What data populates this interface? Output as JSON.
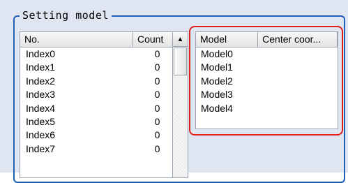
{
  "group": {
    "title": "Setting model"
  },
  "left_list": {
    "columns": [
      "No.",
      "Count"
    ],
    "rows": [
      {
        "no": "Index0",
        "count": "0"
      },
      {
        "no": "Index1",
        "count": "0"
      },
      {
        "no": "Index2",
        "count": "0"
      },
      {
        "no": "Index3",
        "count": "0"
      },
      {
        "no": "Index4",
        "count": "0"
      },
      {
        "no": "Index5",
        "count": "0"
      },
      {
        "no": "Index6",
        "count": "0"
      },
      {
        "no": "Index7",
        "count": "0"
      }
    ],
    "scroll_up_icon": "▲"
  },
  "right_list": {
    "columns": [
      "Model",
      "Center coor..."
    ],
    "rows": [
      "Model0",
      "Model1",
      "Model2",
      "Model3",
      "Model4"
    ]
  },
  "colors": {
    "panel_bg": "#dfe6f1",
    "group_border": "#1f5fb8",
    "highlight": "#e0201c"
  }
}
